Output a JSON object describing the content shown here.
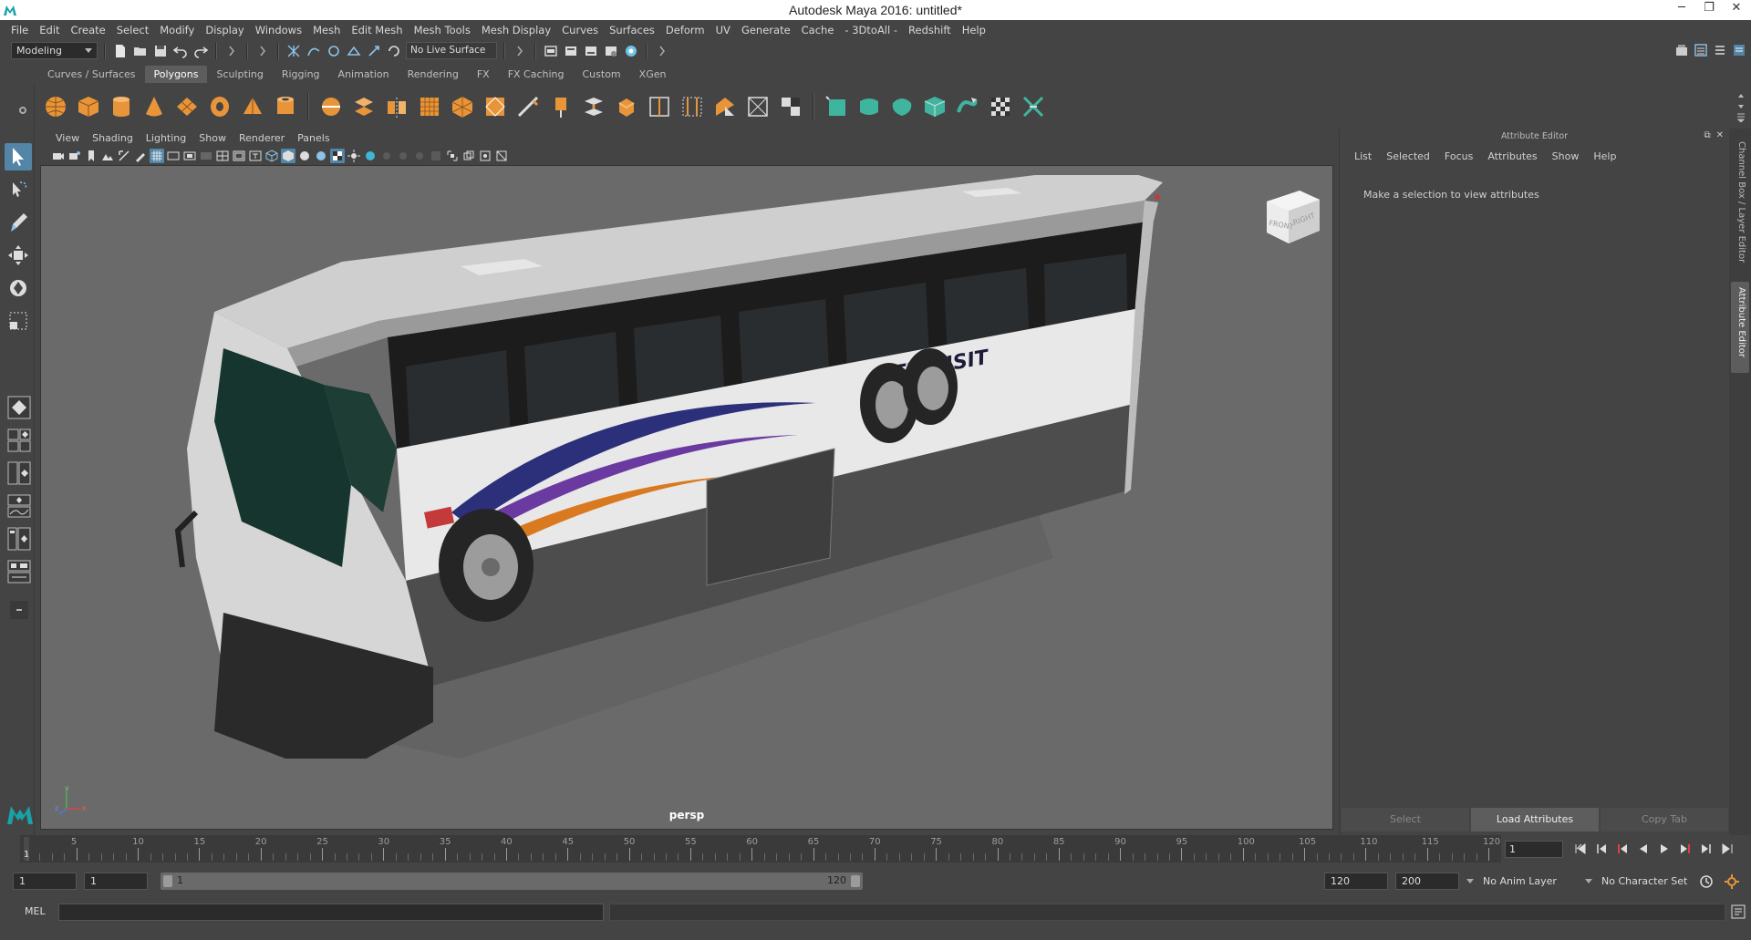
{
  "window": {
    "title": "Autodesk Maya 2016: untitled*",
    "controls": [
      "─",
      "❐",
      "✕"
    ]
  },
  "menubar": [
    "File",
    "Edit",
    "Create",
    "Select",
    "Modify",
    "Display",
    "Windows",
    "Mesh",
    "Edit Mesh",
    "Mesh Tools",
    "Mesh Display",
    "Curves",
    "Surfaces",
    "Deform",
    "UV",
    "Generate",
    "Cache",
    "- 3DtoAll -",
    "Redshift",
    "Help"
  ],
  "statusline": {
    "mode": "Modeling",
    "live_surface": "No Live Surface"
  },
  "shelf": {
    "tabs": [
      "Curves / Surfaces",
      "Polygons",
      "Sculpting",
      "Rigging",
      "Animation",
      "Rendering",
      "FX",
      "FX Caching",
      "Custom",
      "XGen"
    ],
    "active_tab": "Polygons"
  },
  "viewport": {
    "menu": [
      "View",
      "Shading",
      "Lighting",
      "Show",
      "Renderer",
      "Panels"
    ],
    "camera_label": "persp",
    "viewcube": {
      "front": "FRONT",
      "right": "RIGHT"
    },
    "bus_lettering": "TRANSIT",
    "axis": {
      "x": "x",
      "y": "y",
      "z": "z"
    }
  },
  "attribute_editor": {
    "title": "Attribute Editor",
    "menu": [
      "List",
      "Selected",
      "Focus",
      "Attributes",
      "Show",
      "Help"
    ],
    "message": "Make a selection to view attributes",
    "buttons": {
      "select": "Select",
      "load": "Load Attributes",
      "copy": "Copy Tab"
    },
    "panel_controls": {
      "float": "⧉",
      "close": "✕"
    },
    "side_tabs": {
      "channel_box": "Channel Box / Layer Editor",
      "attribute_editor": "Attribute Editor"
    }
  },
  "timeslider": {
    "ticks": [
      "5",
      "10",
      "15",
      "20",
      "25",
      "30",
      "35",
      "40",
      "45",
      "50",
      "55",
      "60",
      "65",
      "70",
      "75",
      "80",
      "85",
      "90",
      "95",
      "100",
      "105",
      "110",
      "115",
      "120"
    ],
    "current_frame": "1",
    "current_field": "1"
  },
  "range": {
    "start": "1",
    "playback_start": "1",
    "slider_start": "1",
    "slider_end": "120",
    "playback_end": "120",
    "end": "200",
    "anim_layer": "No Anim Layer",
    "character_set": "No Character Set"
  },
  "cmdline": {
    "label": "MEL"
  },
  "colors": {
    "accent": "#5285a6",
    "background": "#444444",
    "viewport_bg": "#6a6a6a",
    "shelf_orange": "#e8953a",
    "shelf_teal": "#3fb5a0"
  }
}
